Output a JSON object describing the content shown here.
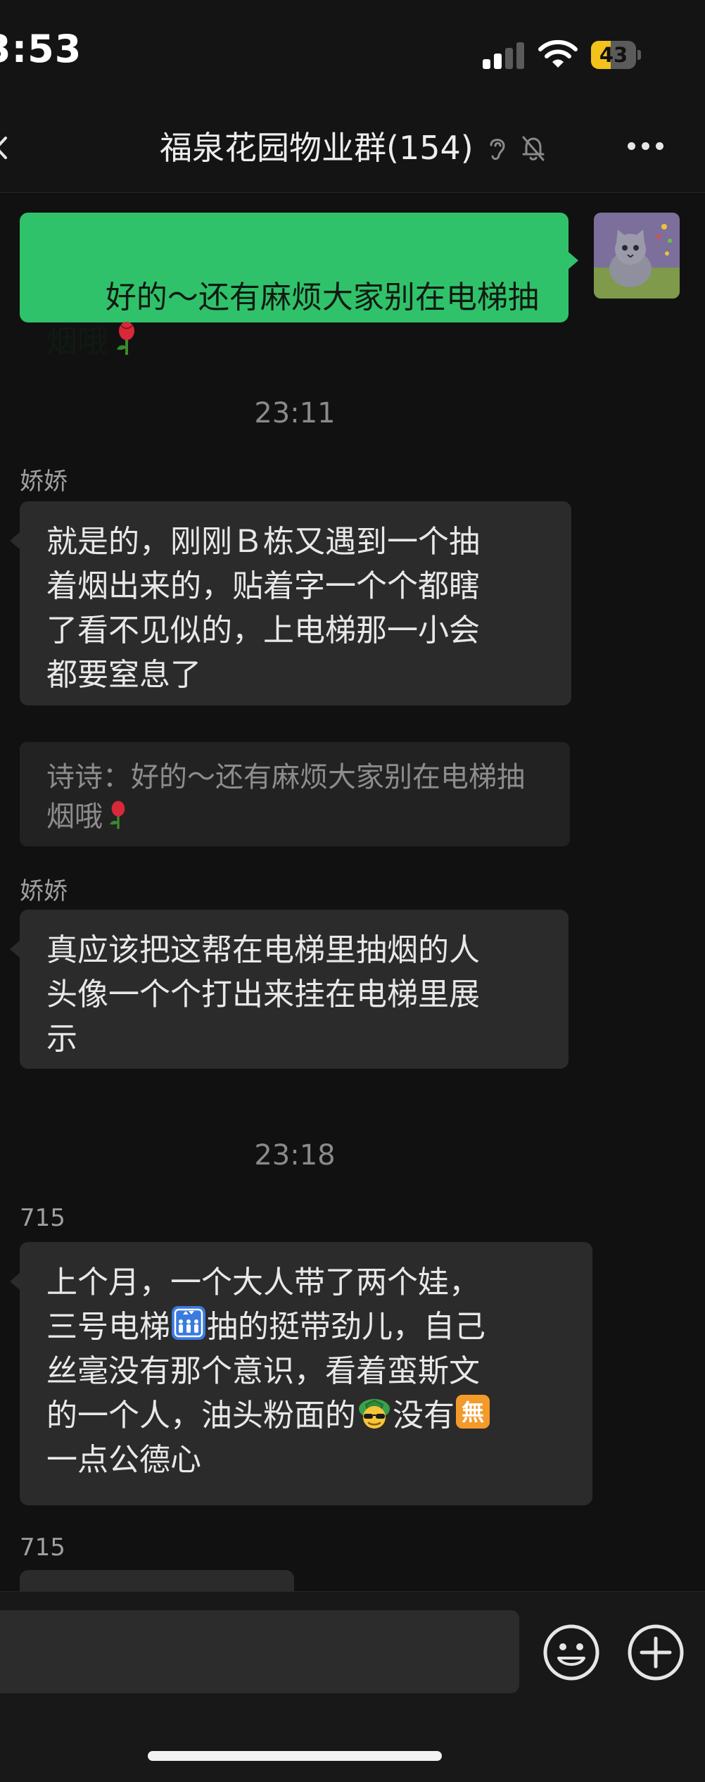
{
  "status_bar": {
    "time": "3:53",
    "battery_level": "43",
    "battery_fraction": 0.43
  },
  "nav": {
    "title": "福泉花园物业群(154)"
  },
  "messages": {
    "m1": {
      "text": "好的～还有麻烦大家别在电梯抽\n烟哦"
    },
    "time1": "23:11",
    "m2": {
      "sender": "娇娇",
      "text": "就是的，刚刚Ｂ栋又遇到一个抽\n着烟出来的，贴着字一个个都瞎\n了看不见似的，上电梯那一小会\n都要窒息了",
      "quote": "诗诗：好的～还有麻烦大家别在电梯抽\n烟哦"
    },
    "m3": {
      "sender": "娇娇",
      "text": "真应该把这帮在电梯里抽烟的人\n头像一个个打出来挂在电梯里展\n示"
    },
    "time2": "23:18",
    "m4": {
      "sender": "715",
      "line1": "上个月，一个大人带了两个娃，",
      "line2a": "三号电梯",
      "line2b": "抽的挺带劲儿，自己",
      "line3": "丝毫没有那个意识，看着蛮斯文",
      "line4a": "的一个人，油头粉面的",
      "line4b": "没有",
      "line5": "一点公德心",
      "emoji_box_text": "無"
    },
    "m5": {
      "sender": "715"
    }
  },
  "input": {
    "placeholder": ""
  },
  "colors": {
    "my_bubble": "#30c26a",
    "other_bubble": "#2b2b2b",
    "background": "#111111"
  },
  "icons": [
    "back-arrow-icon",
    "ear-icon",
    "mute-bell-icon",
    "more-icon",
    "rose-icon",
    "elevator-icon",
    "turtle-emoji-icon",
    "mu-sign-icon",
    "emoji-icon",
    "plus-icon",
    "signal-icon",
    "wifi-icon",
    "battery-icon"
  ]
}
